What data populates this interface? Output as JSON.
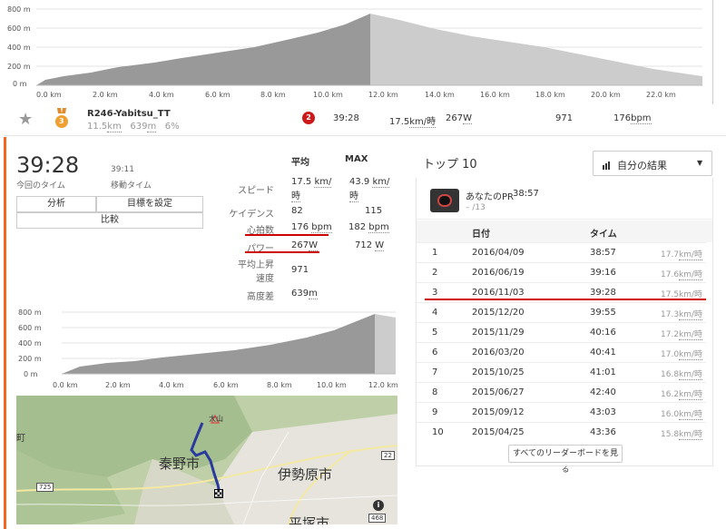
{
  "top_chart": {
    "y_ticks": [
      "800 m",
      "600 m",
      "400 m",
      "200 m",
      "0 m"
    ],
    "x_ticks": [
      "0.0 km",
      "2.0 km",
      "4.0 km",
      "6.0 km",
      "8.0 km",
      "10.0 km",
      "12.0 km",
      "14.0 km",
      "16.0 km",
      "18.0 km",
      "20.0 km",
      "22.0 km"
    ]
  },
  "segment": {
    "name": "R246-Yabitsu_TT",
    "distance": "11.5",
    "distance_unit": "km",
    "elev": "639",
    "elev_unit": "m",
    "grade": "6",
    "grade_unit": "%",
    "medal_rank": "3",
    "rank_badge": "2",
    "time": "39:28",
    "speed": "17.5",
    "speed_unit": "km/時",
    "power": "267",
    "power_unit": "W",
    "elev_gain": "971",
    "hr": "176",
    "hr_unit": "bpm"
  },
  "effort": {
    "big_time": "39:28",
    "big_time_label": "今回のタイム",
    "moving_time": "39:11",
    "moving_time_label": "移動タイム",
    "btn_analysis": "分析",
    "btn_goal": "目標を設定",
    "btn_compare": "比較"
  },
  "stats": {
    "header_avg": "平均",
    "header_max": "MAX",
    "speed_label": "スピード",
    "speed_avg": "17.5",
    "speed_max": "43.9",
    "speed_unit_a": "km/",
    "speed_unit_b": "時",
    "cadence_label": "ケイデンス",
    "cadence_avg": "82",
    "cadence_max": "115",
    "hr_label": "心拍数",
    "hr_avg": "176",
    "hr_max": "182",
    "hr_unit": "bpm",
    "power_label": "パワー",
    "power_avg": "267",
    "power_max": "712",
    "power_unit": "W",
    "vam_label_1": "平均上昇",
    "vam_label_2": "速度",
    "vam_val": "971",
    "elev_label": "高度差",
    "elev_val": "639",
    "elev_unit": "m"
  },
  "small_chart": {
    "y_ticks": [
      "800 m",
      "600 m",
      "400 m",
      "200 m",
      "0 m"
    ],
    "x_ticks": [
      "0.0 km",
      "2.0 km",
      "4.0 km",
      "6.0 km",
      "8.0 km",
      "10.0 km",
      "12.0 km"
    ]
  },
  "map": {
    "label_hadano": "秦野市",
    "label_isehara": "伊勢原市",
    "label_hiratsuka": "平塚市",
    "label_oyama": "大山",
    "road_725": "725",
    "road_22": "22",
    "road_468": "468",
    "cho": "町",
    "info": "i"
  },
  "leaderboard": {
    "title": "トップ 10",
    "filter_label": "自分の結果",
    "pr_label": "あなたのPR",
    "pr_time": "38:57",
    "pr_rank": "– /13",
    "col_date": "日付",
    "col_time": "タイム",
    "speed_unit": "km/時",
    "rows": [
      {
        "rank": "1",
        "date": "2016/04/09",
        "time": "38:57",
        "speed": "17.7"
      },
      {
        "rank": "2",
        "date": "2016/06/19",
        "time": "39:16",
        "speed": "17.6"
      },
      {
        "rank": "3",
        "date": "2016/11/03",
        "time": "39:28",
        "speed": "17.5"
      },
      {
        "rank": "4",
        "date": "2015/12/20",
        "time": "39:55",
        "speed": "17.3"
      },
      {
        "rank": "5",
        "date": "2015/11/29",
        "time": "40:16",
        "speed": "17.2"
      },
      {
        "rank": "6",
        "date": "2016/03/20",
        "time": "40:41",
        "speed": "17.0"
      },
      {
        "rank": "7",
        "date": "2015/10/25",
        "time": "41:01",
        "speed": "16.8"
      },
      {
        "rank": "8",
        "date": "2015/06/27",
        "time": "42:40",
        "speed": "16.2"
      },
      {
        "rank": "9",
        "date": "2015/09/12",
        "time": "43:03",
        "speed": "16.0"
      },
      {
        "rank": "10",
        "date": "2015/04/25",
        "time": "43:36",
        "speed": "15.8"
      }
    ],
    "view_all": "すべてのリーダーボードを見る"
  },
  "colors": {
    "accent": "#f06622",
    "highlight": "#cc0000",
    "route": "#2a3a9c",
    "chart_fill": "#999999",
    "chart_fill_light": "#cccccc"
  }
}
